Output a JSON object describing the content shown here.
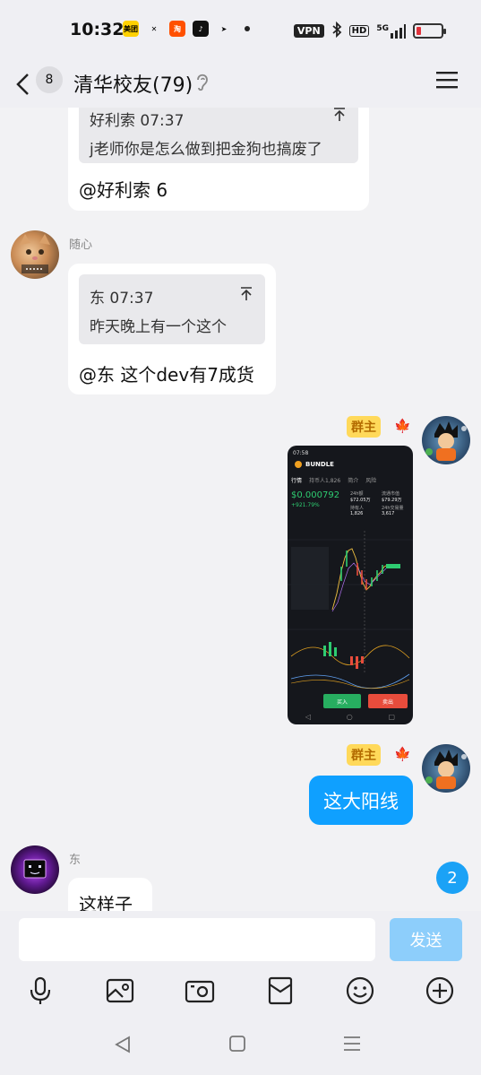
{
  "status_bar": {
    "time": "10:32",
    "apps": [
      {
        "name": "meituan-icon",
        "label": "美团",
        "color": "#ffd100"
      },
      {
        "name": "crosshatch-icon",
        "label": "✕",
        "color": "#efeff3"
      },
      {
        "name": "taobao-icon",
        "label": "淘",
        "color": "#ff5000"
      },
      {
        "name": "tiktok-icon",
        "label": "♪",
        "color": "#111111"
      },
      {
        "name": "telegram-icon",
        "label": "➤",
        "color": "#efeff3"
      }
    ],
    "vpn": "VPN",
    "hd": "HD",
    "network": "5G",
    "battery_level": 0.18
  },
  "header": {
    "back_count": "8",
    "title": "清华校友(79)"
  },
  "messages": {
    "msg1": {
      "quote_head": "好利索 07:37",
      "quote_body": "j老师你是怎么做到把金狗也搞废了",
      "text": "@好利索 6"
    },
    "msg2": {
      "sender": "随心",
      "quote_head": "东 07:37",
      "quote_body": "昨天晚上有一个这个",
      "text": "@东 这个dev有7成货"
    },
    "msg3": {
      "badge": "群主",
      "thumb": {
        "time": "07:58",
        "token": "BUNDLE",
        "tabs": [
          "行情",
          "持币人1,826",
          "简介",
          "风险"
        ],
        "price": "$0.000792",
        "change": "+921.79%",
        "stats": [
          [
            "24h额",
            "$72.05万"
          ],
          [
            "流通市值",
            "$79.29万"
          ],
          [
            "持有人",
            "1,826"
          ],
          [
            "24h交易量",
            "3,617"
          ]
        ],
        "buy": "买入",
        "sell": "卖出"
      }
    },
    "msg4": {
      "badge": "群主",
      "text": "这大阳线"
    },
    "msg5": {
      "sender": "东",
      "text": "这样子"
    },
    "unread_count": "2"
  },
  "input": {
    "placeholder": "",
    "send_label": "发送"
  },
  "colors": {
    "accent": "#0fa0ff",
    "send_disabled": "#8dcefb",
    "owner_badge": "#ffd95a"
  }
}
